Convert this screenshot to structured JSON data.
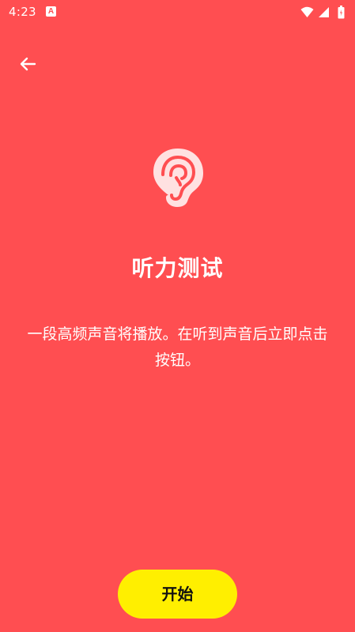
{
  "status_bar": {
    "time": "4:23",
    "notification_icon": "a-notification-icon",
    "notification_letter": "A",
    "icons": [
      "wifi-icon",
      "cell-signal-icon",
      "battery-icon"
    ]
  },
  "header": {
    "back_icon": "arrow-left-icon"
  },
  "main": {
    "icon": "ear-icon",
    "title": "听力测试",
    "description": "一段高频声音将播放。在听到声音后立即点击按钮。"
  },
  "footer": {
    "start_label": "开始"
  },
  "colors": {
    "background": "#FF4E51",
    "button": "#FFEF00",
    "icon_fill": "#FFE1E1",
    "icon_stroke": "#FF4E51"
  }
}
